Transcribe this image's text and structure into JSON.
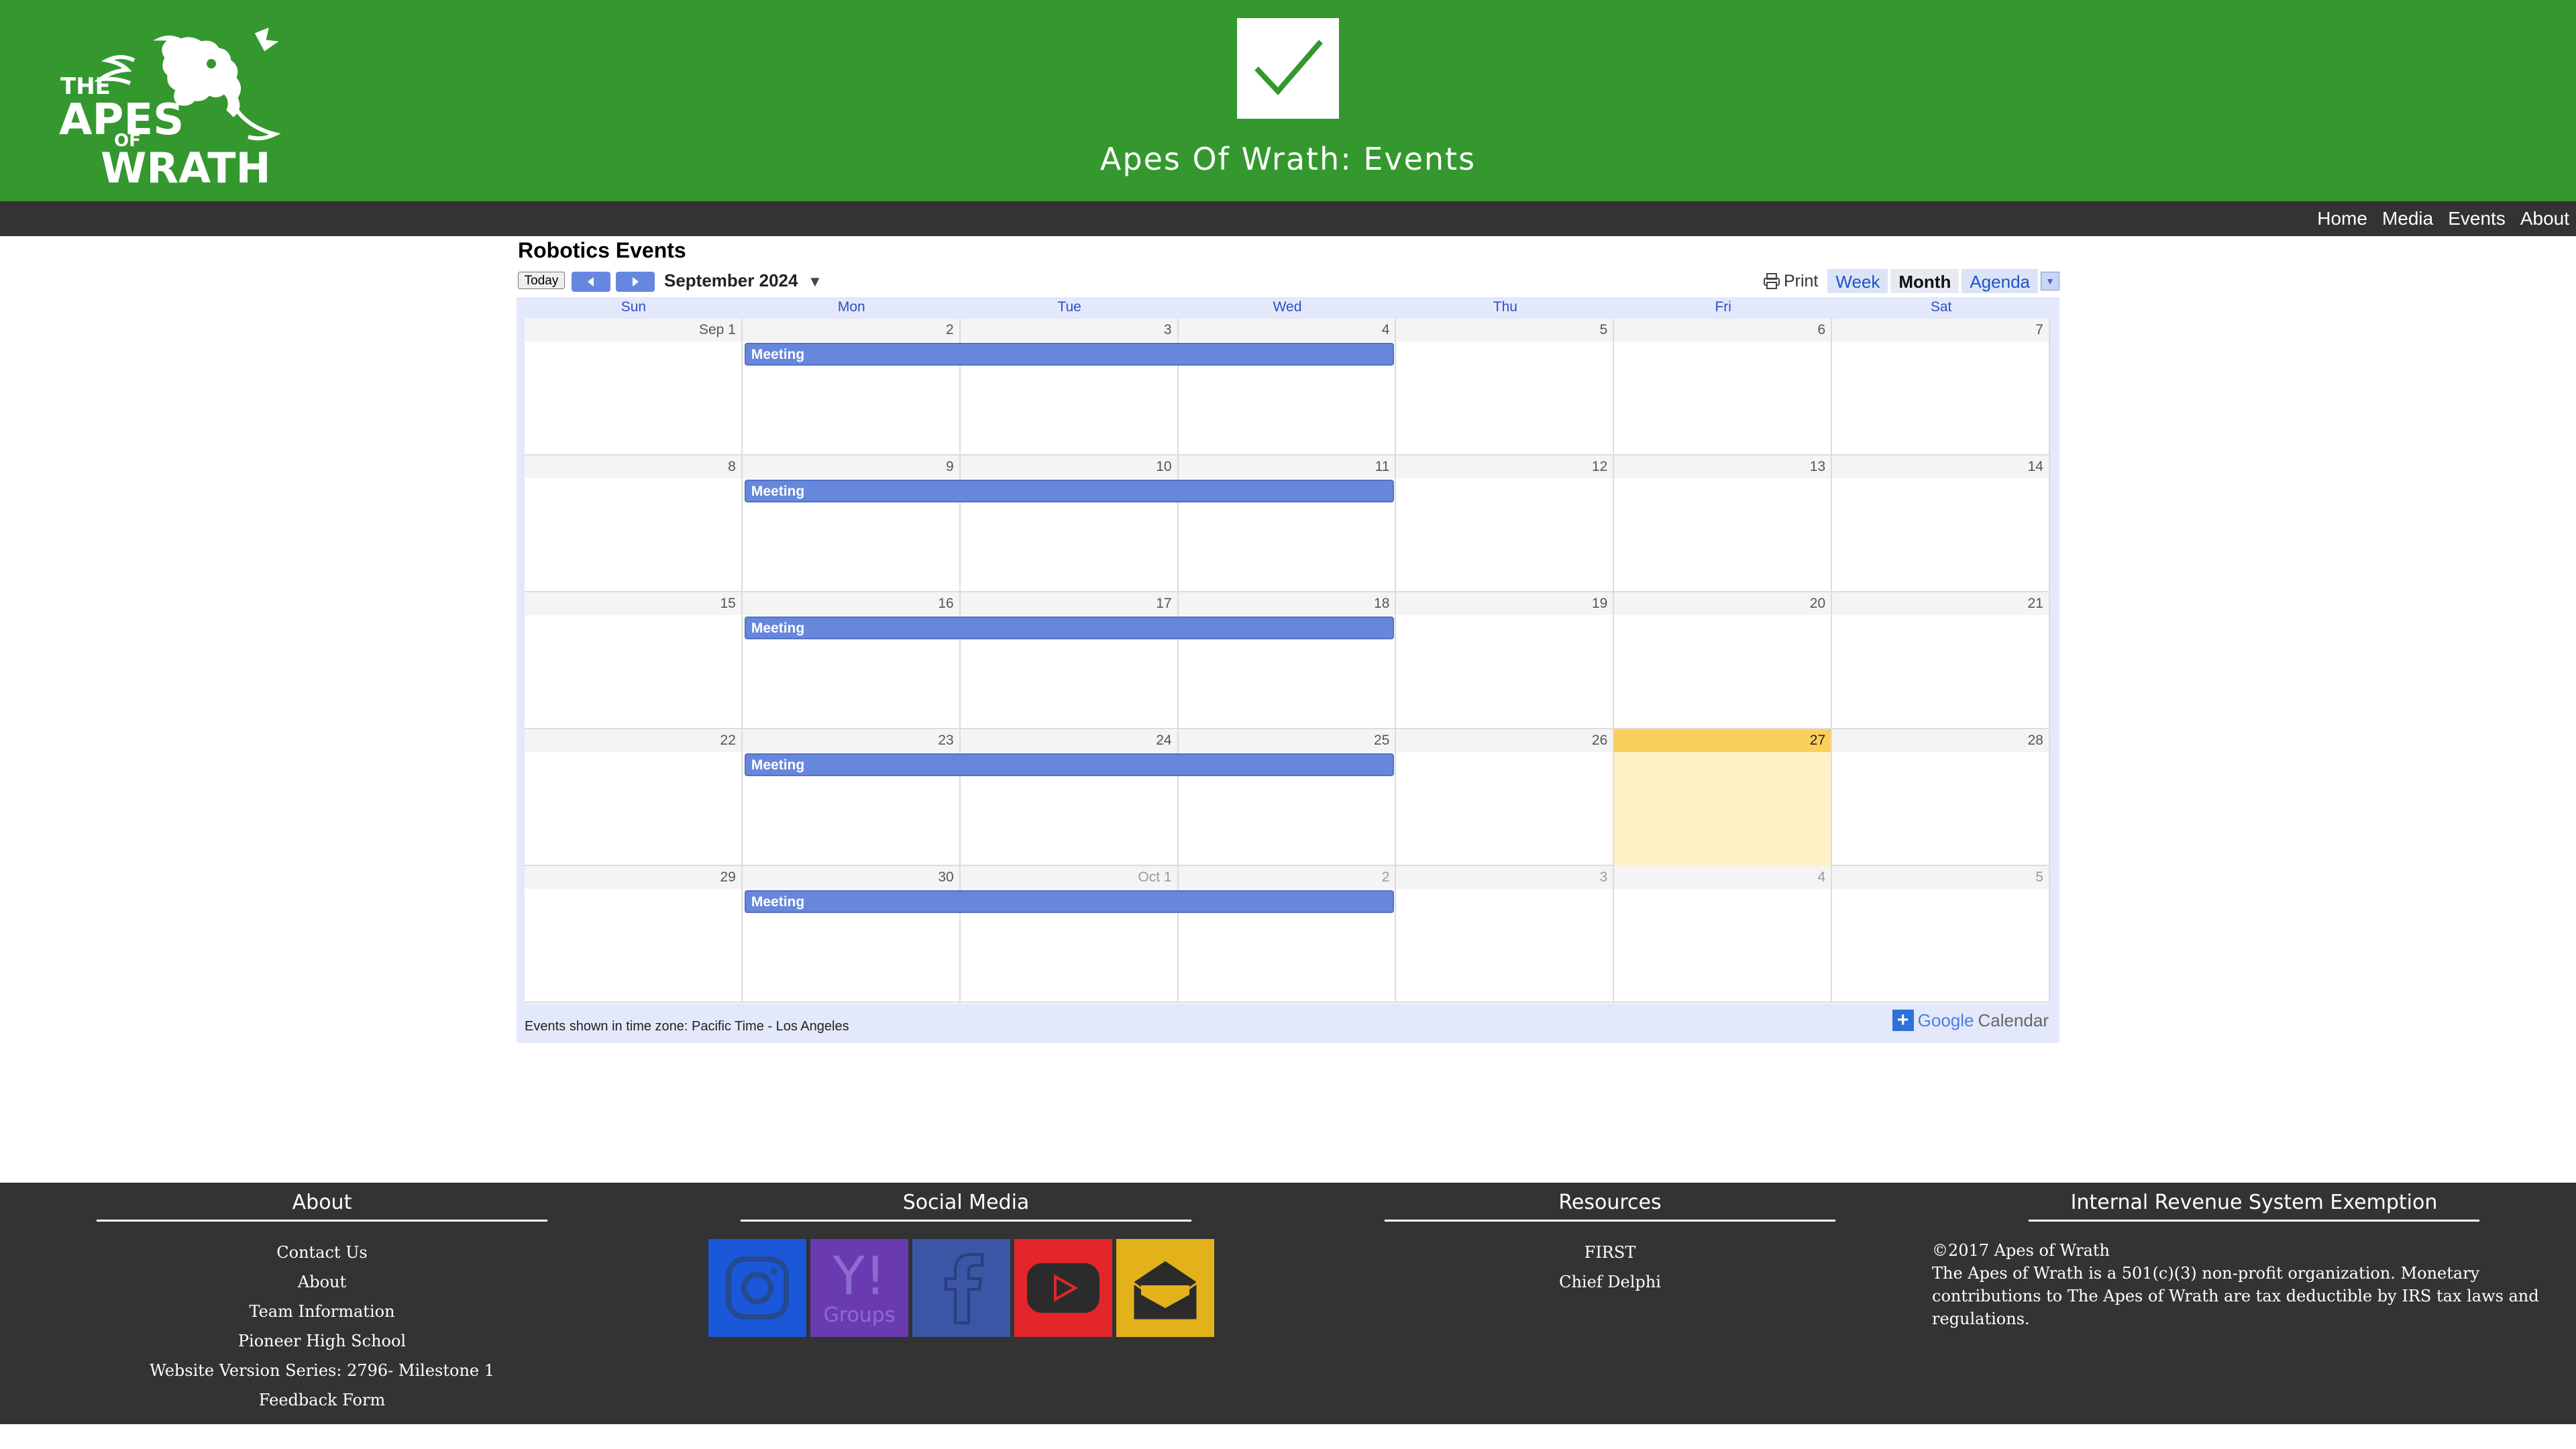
{
  "header": {
    "logo_text": [
      "THE",
      "APES",
      "OF",
      "WRATH"
    ],
    "title": "Apes Of Wrath: Events",
    "brand_color": "#34982f"
  },
  "nav": {
    "items": [
      "Home",
      "Media",
      "Events",
      "About"
    ]
  },
  "calendar": {
    "title": "Robotics Events",
    "today_label": "Today",
    "month_label": "September 2024",
    "print_label": "Print",
    "tabs": [
      "Week",
      "Month",
      "Agenda"
    ],
    "active_tab": "Month",
    "days_of_week": [
      "Sun",
      "Mon",
      "Tue",
      "Wed",
      "Thu",
      "Fri",
      "Sat"
    ],
    "weeks": [
      [
        "Sep 1",
        "2",
        "3",
        "4",
        "5",
        "6",
        "7"
      ],
      [
        "8",
        "9",
        "10",
        "11",
        "12",
        "13",
        "14"
      ],
      [
        "15",
        "16",
        "17",
        "18",
        "19",
        "20",
        "21"
      ],
      [
        "22",
        "23",
        "24",
        "25",
        "26",
        "27",
        "28"
      ],
      [
        "29",
        "30",
        "Oct 1",
        "2",
        "3",
        "4",
        "5"
      ]
    ],
    "today": "27",
    "event_label": "Meeting",
    "timezone_note": "Events shown in time zone: Pacific Time - Los Angeles",
    "gcal_google": "Google",
    "gcal_calendar": "Calendar"
  },
  "footer": {
    "about": {
      "heading": "About",
      "links": [
        "Contact Us",
        "About",
        "Team Information",
        "Pioneer High School",
        "Website Version Series: 2796- Milestone 1",
        "Feedback Form"
      ]
    },
    "social": {
      "heading": "Social Media",
      "icons": [
        "instagram-icon",
        "yahoo-groups-icon",
        "facebook-icon",
        "youtube-icon",
        "email-icon"
      ],
      "yahoo_text": "Y!",
      "groups_text": "Groups"
    },
    "resources": {
      "heading": "Resources",
      "links": [
        "FIRST",
        "Chief Delphi"
      ]
    },
    "irs": {
      "heading": "Internal Revenue System Exemption",
      "copyright": "©2017 Apes of Wrath",
      "text": "The Apes of Wrath is a 501(c)(3) non-profit organization. Monetary contributions to The Apes of Wrath are tax deductible by IRS tax laws and regulations."
    }
  }
}
